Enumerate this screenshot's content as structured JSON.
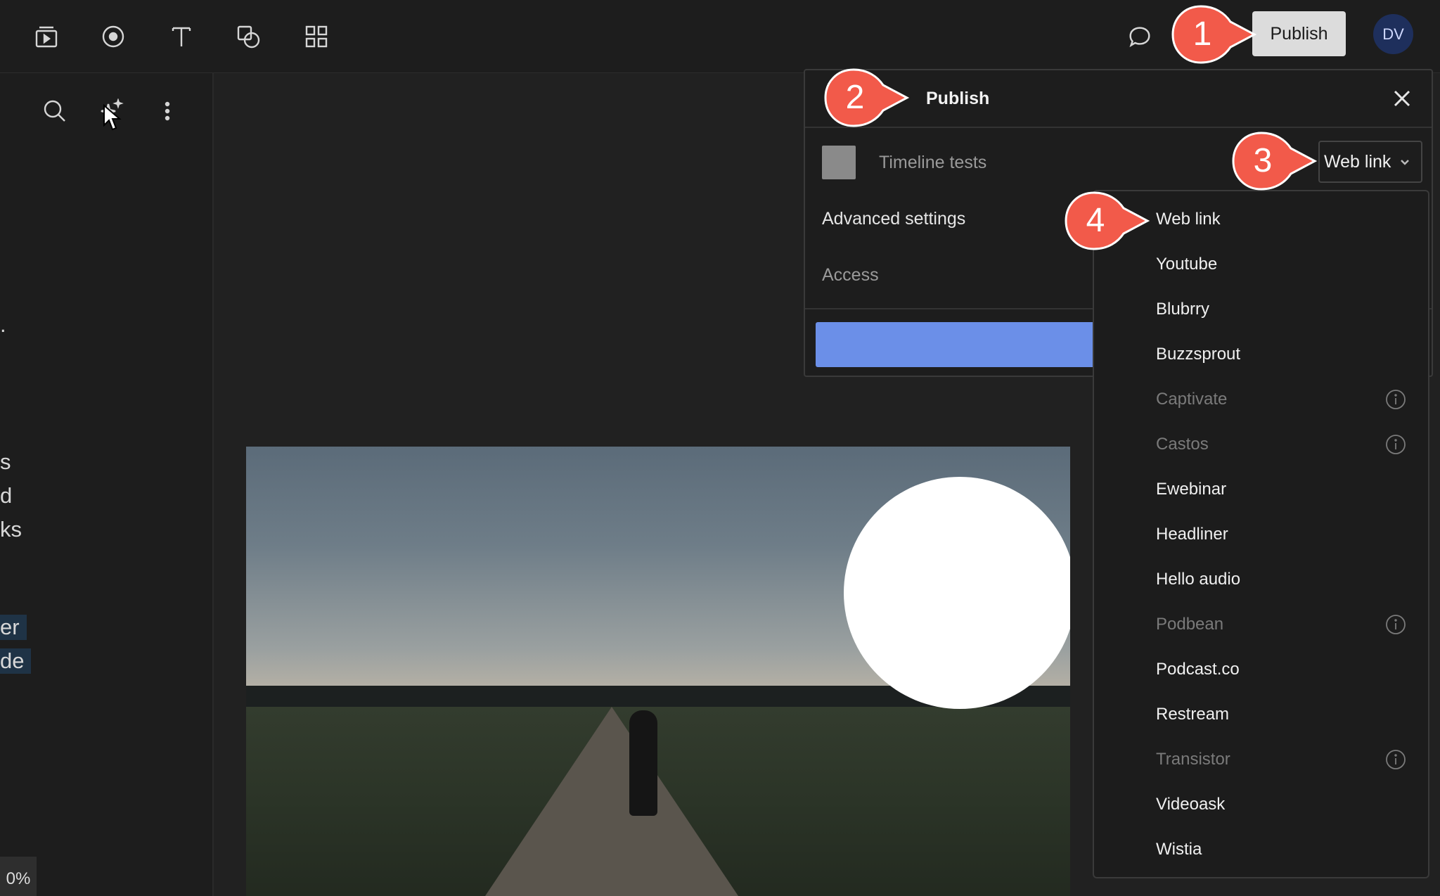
{
  "topbar": {
    "tools": [
      {
        "name": "media-icon"
      },
      {
        "name": "record-icon"
      },
      {
        "name": "text-icon"
      },
      {
        "name": "shapes-icon"
      },
      {
        "name": "grid-icon"
      }
    ],
    "publish_label": "Publish",
    "avatar_initials": "DV"
  },
  "left_panel": {
    "fragments": [
      ".",
      "s",
      "d",
      "ks",
      "er",
      "de"
    ],
    "zoom_label": "0%"
  },
  "dialog": {
    "title": "Publish",
    "project_name": "Timeline tests",
    "destination": "Web link",
    "advanced_label": "Advanced settings",
    "access_label": "Access"
  },
  "dropdown": {
    "items": [
      {
        "label": "Web link",
        "disabled": false
      },
      {
        "label": "Youtube",
        "disabled": false
      },
      {
        "label": "Blubrry",
        "disabled": false
      },
      {
        "label": "Buzzsprout",
        "disabled": false
      },
      {
        "label": "Captivate",
        "disabled": true
      },
      {
        "label": "Castos",
        "disabled": true
      },
      {
        "label": "Ewebinar",
        "disabled": false
      },
      {
        "label": "Headliner",
        "disabled": false
      },
      {
        "label": "Hello audio",
        "disabled": false
      },
      {
        "label": "Podbean",
        "disabled": true
      },
      {
        "label": "Podcast.co",
        "disabled": false
      },
      {
        "label": "Restream",
        "disabled": false
      },
      {
        "label": "Transistor",
        "disabled": true
      },
      {
        "label": "Videoask",
        "disabled": false
      },
      {
        "label": "Wistia",
        "disabled": false
      }
    ]
  },
  "callouts": [
    "1",
    "2",
    "3",
    "4"
  ],
  "colors": {
    "callout": "#f25a4a",
    "primary_button": "#6b8fe8",
    "avatar_bg": "#1e2f5c"
  }
}
